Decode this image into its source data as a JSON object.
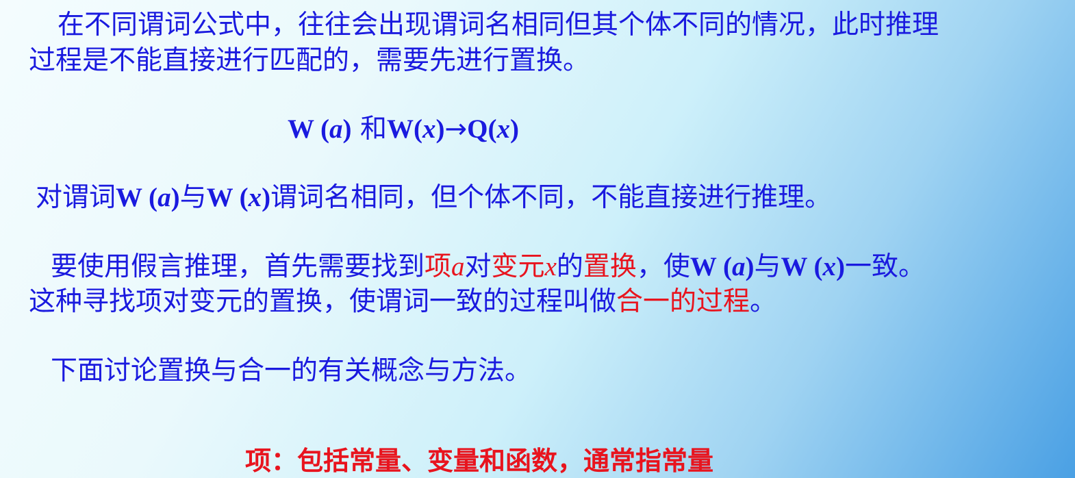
{
  "paragraph1": {
    "line1": "在不同谓词公式中，往往会出现谓词名相同但其个体不同的情况，此时推理",
    "line2": "过程是不能直接进行匹配的，需要先进行置换。"
  },
  "formula": {
    "w": "W",
    "lp1": " (",
    "a": "a",
    "rp1": ")",
    "and": " 和",
    "w2": "W",
    "lp2": "(",
    "x1": "x",
    "rp2": ")",
    "arrow": "→",
    "q": "Q",
    "lp3": "(",
    "x2": "x",
    "rp3": ")"
  },
  "paragraph2": {
    "prefix": "对谓词",
    "wa": "W (",
    "a": "a",
    "close1": ")",
    "and": "与",
    "wx": "W (",
    "x": "x",
    "close2": ")",
    "suffix": "谓词名相同，但个体不同，不能直接进行推理。"
  },
  "paragraph3": {
    "prefix": "要使用假言推理，首先需要找到",
    "term": "项",
    "a": "a",
    "to": "对",
    "variable": "变元",
    "x": "x",
    "of": "的",
    "substitution": "置换",
    "comma_make": "，使",
    "wa": "W (",
    "a2": "a",
    "close1": ")",
    "and": "与",
    "wx": "W (",
    "x2": "x",
    "close2": ")",
    "consistent": "一致。",
    "line2_prefix": "这种寻找项对变元的置换，使谓词一致的过程叫做",
    "unification": "合一的过程",
    "period": "。"
  },
  "paragraph4": "下面讨论置换与合一的有关概念与方法。",
  "note": "项：包括常量、变量和函数，通常指常量"
}
